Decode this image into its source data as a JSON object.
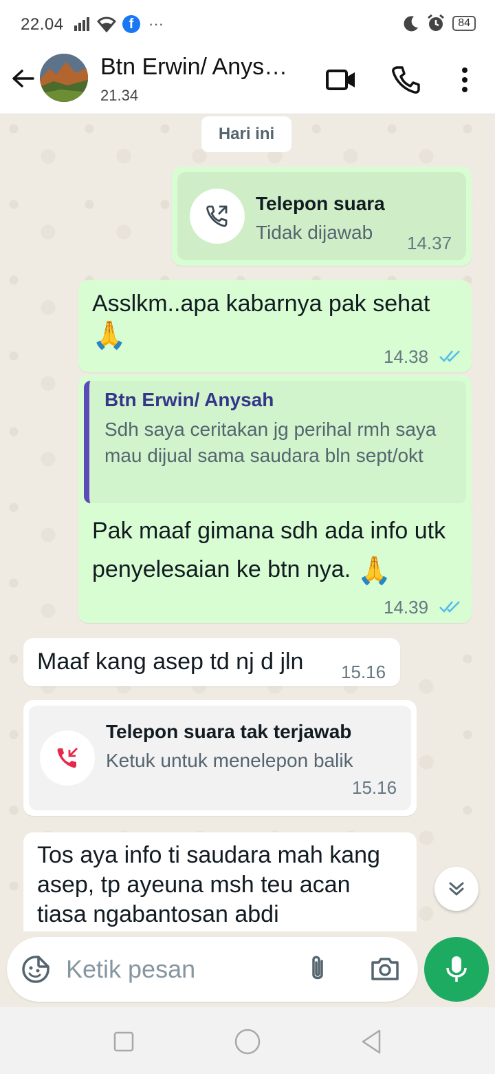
{
  "status_bar": {
    "time": "22.04",
    "battery": "84",
    "icons": [
      "signal-icon",
      "wifi-icon",
      "facebook-icon",
      "more-dots-icon",
      "moon-icon",
      "alarm-icon",
      "battery-icon"
    ]
  },
  "header": {
    "contact_name": "Btn Erwin/ Anys…",
    "subtitle": "21.34",
    "icons": [
      "back-arrow-icon",
      "video-call-icon",
      "voice-call-icon",
      "menu-dots-icon"
    ]
  },
  "chat": {
    "day_label": "Hari ini",
    "messages": [
      {
        "type": "call_out",
        "title": "Telepon suara",
        "subtitle": "Tidak dijawab",
        "time": "14.37"
      },
      {
        "type": "text_out",
        "text": "Asslkm..apa kabarnya pak sehat",
        "emoji": "🙏",
        "time": "14.38",
        "status": "read"
      },
      {
        "type": "reply_out",
        "quote_name": "Btn Erwin/ Anysah",
        "quote_text": "Sdh saya ceritakan jg perihal rmh saya mau dijual sama saudara bln sept/okt",
        "text": "Pak maaf gimana sdh ada info utk penyelesaian ke btn nya.",
        "emoji": "🙏",
        "time": "14.39",
        "status": "read"
      },
      {
        "type": "text_in",
        "text": "Maaf kang asep td nj d jln",
        "time": "15.16"
      },
      {
        "type": "call_in_missed",
        "title": "Telepon suara tak terjawab",
        "subtitle": "Ketuk untuk menelepon balik",
        "time": "15.16"
      },
      {
        "type": "text_in",
        "text": "Tos aya info ti saudara mah kang asep, tp ayeuna msh teu acan tiasa ngabantosan abdi"
      }
    ]
  },
  "input": {
    "placeholder": "Ketik pesan"
  },
  "colors": {
    "outgoing_bubble": "#d9fdd3",
    "incoming_bubble": "#ffffff",
    "chat_background": "#efeae2",
    "accent_green": "#1daa61",
    "read_ticks": "#53bdeb",
    "missed_call_red": "#e6294b"
  }
}
